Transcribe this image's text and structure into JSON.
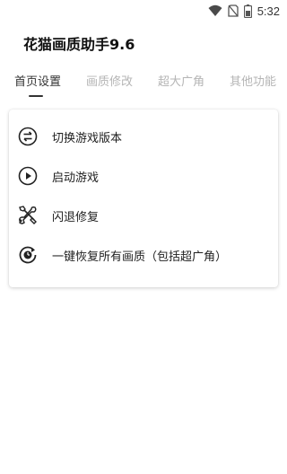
{
  "status_bar": {
    "time": "5:32",
    "icons": [
      "wifi-icon",
      "sim-no-signal-icon",
      "battery-icon"
    ]
  },
  "app": {
    "title": "花猫画质助手9.6"
  },
  "tabs": [
    {
      "label": "首页设置",
      "active": true
    },
    {
      "label": "画质修改",
      "active": false
    },
    {
      "label": "超大广角",
      "active": false
    },
    {
      "label": "其他功能",
      "active": false
    }
  ],
  "menu": {
    "items": [
      {
        "label": "切换游戏版本",
        "icon": "switch-icon"
      },
      {
        "label": "启动游戏",
        "icon": "play-circle-icon"
      },
      {
        "label": "闪退修复",
        "icon": "tools-icon"
      },
      {
        "label": "一键恢复所有画质（包括超广角）",
        "icon": "restore-icon"
      }
    ]
  },
  "colors": {
    "background": "#ffffff",
    "text": "#212121",
    "tab_inactive": "#b5b5b5",
    "tab_active": "#333333"
  }
}
